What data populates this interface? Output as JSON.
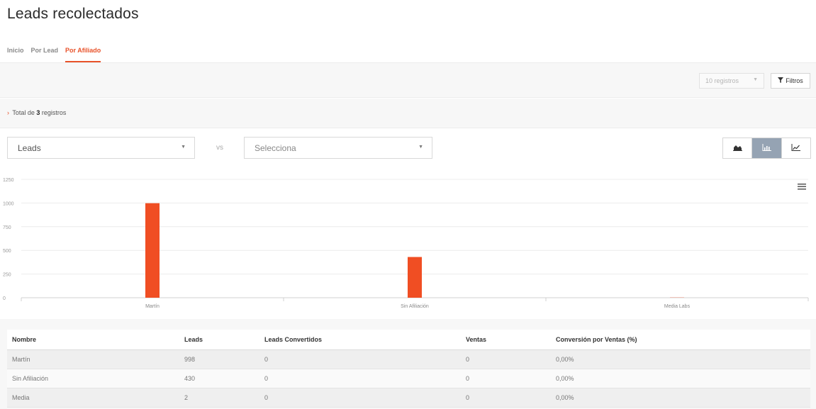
{
  "page": {
    "title": "Leads recolectados"
  },
  "tabs": [
    {
      "label": "Inicio"
    },
    {
      "label": "Por Lead"
    },
    {
      "label": "Por Afiliado"
    }
  ],
  "toolbar": {
    "records_select": "10 registros",
    "filters_label": "Filtros"
  },
  "totals": {
    "prefix": "Total de",
    "count": "3",
    "suffix": "registros"
  },
  "controls": {
    "metric_primary": "Leads",
    "vs_label": "vs",
    "metric_secondary": "Selecciona",
    "view_modes": [
      {
        "icon": "area-chart-icon"
      },
      {
        "icon": "bar-chart-icon"
      },
      {
        "icon": "line-chart-icon"
      }
    ]
  },
  "colors": {
    "accent": "#e8522a",
    "bar": "#f04e23",
    "active_toggle": "#95a3b3"
  },
  "chart_data": {
    "type": "bar",
    "categories": [
      "Martín",
      "Sin Afiliación",
      "Media Labs"
    ],
    "values": [
      998,
      430,
      2
    ],
    "ylim": [
      0,
      1250
    ],
    "yticks": [
      0,
      250,
      500,
      750,
      1000,
      1250
    ],
    "grid": true,
    "title": "",
    "xlabel": "",
    "ylabel": ""
  },
  "table": {
    "headers": [
      "Nombre",
      "Leads",
      "Leads Convertidos",
      "Ventas",
      "Conversión por Ventas (%)"
    ],
    "rows": [
      [
        "Martín",
        "998",
        "0",
        "0",
        "0,00%"
      ],
      [
        "Sin Afiliación",
        "430",
        "0",
        "0",
        "0,00%"
      ],
      [
        "Media",
        "2",
        "0",
        "0",
        "0,00%"
      ]
    ]
  }
}
